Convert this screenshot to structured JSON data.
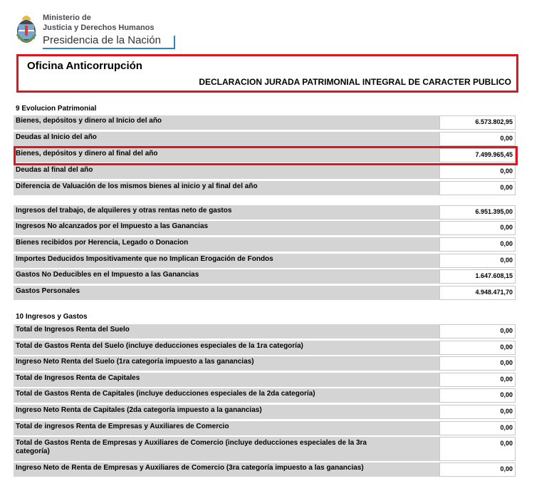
{
  "header": {
    "ministry_line1": "Ministerio de",
    "ministry_line2": "Justicia y Derechos Humanos",
    "presidency": "Presidencia de la Nación",
    "office": "Oficina Anticorrupción",
    "declaration_title": "DECLARACION JURADA PATRIMONIAL INTEGRAL DE CARACTER PUBLICO"
  },
  "section9": {
    "title": "9 Evolucion Patrimonial",
    "rows": [
      {
        "label": "Bienes, depósitos y dinero al Inicio del año",
        "value": "6.573.802,95"
      },
      {
        "label": "Deudas al Inicio del año",
        "value": "0,00"
      },
      {
        "label": "Bienes, depósitos y dinero al final del año",
        "value": "7.499.965,45"
      },
      {
        "label": "Deudas al final del año",
        "value": "0,00"
      },
      {
        "label": "Diferencia de Valuación de los mismos bienes al inicio y al final del año",
        "value": "0,00"
      }
    ],
    "rows2": [
      {
        "label": "Ingresos del trabajo, de alquileres y otras rentas neto de gastos",
        "value": "6.951.395,00"
      },
      {
        "label": "Ingresos No alcanzados por el Impuesto a las Ganancias",
        "value": "0,00"
      },
      {
        "label": "Bienes recibidos por Herencia, Legado o Donacion",
        "value": "0,00"
      },
      {
        "label": "Importes Deducidos Impositivamente que no Implican Erogación de Fondos",
        "value": "0,00"
      },
      {
        "label": "Gastos No Deducibles en el Impuesto a las Ganancias",
        "value": "1.647.608,15"
      },
      {
        "label": "Gastos Personales",
        "value": "4.948.471,70"
      }
    ]
  },
  "section10": {
    "title": "10 Ingresos y Gastos",
    "rows": [
      {
        "label": "Total de Ingresos Renta del Suelo",
        "value": "0,00"
      },
      {
        "label": "Total de Gastos Renta del Suelo (incluye deducciones especiales de la 1ra categoría)",
        "value": "0,00"
      },
      {
        "label": "Ingreso Neto Renta del Suelo (1ra categoría impuesto a las ganancias)",
        "value": "0,00"
      },
      {
        "label": "Total de Ingresos Renta de Capitales",
        "value": "0,00"
      },
      {
        "label": "Total de Gastos Renta de Capitales (incluye deducciones especiales de la 2da categoría)",
        "value": "0,00"
      },
      {
        "label": "Ingreso Neto Renta de Capitales (2da categoría impuesto a la ganancias)",
        "value": "0,00"
      },
      {
        "label": "Total de ingresos Renta de Empresas y Auxiliares de Comercio",
        "value": "0,00"
      },
      {
        "label": "Total de Gastos Renta de Empresas y Auxiliares de Comercio (incluye deducciones especiales de la 3ra categoría)",
        "value": "0,00"
      },
      {
        "label": "Ingreso Neto de Renta de Empresas y Auxiliares de Comercio (3ra categoría impuesto a las ganancias)",
        "value": "0,00"
      }
    ]
  }
}
